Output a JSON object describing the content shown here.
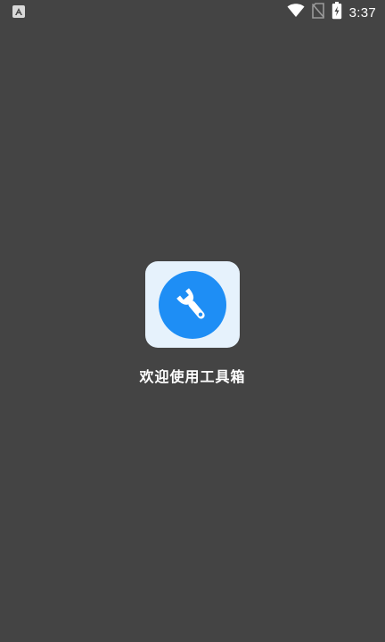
{
  "status_bar": {
    "time": "3:37",
    "icons": [
      "notification-a-icon",
      "wifi-icon",
      "no-sim-icon",
      "battery-charging-icon"
    ]
  },
  "splash": {
    "app_icon": "wrench-icon",
    "welcome_text": "欢迎使用工具箱"
  },
  "colors": {
    "background": "#444444",
    "icon_tile": "#e6f2fc",
    "icon_circle": "#1e8ef5",
    "text": "#ffffff"
  }
}
